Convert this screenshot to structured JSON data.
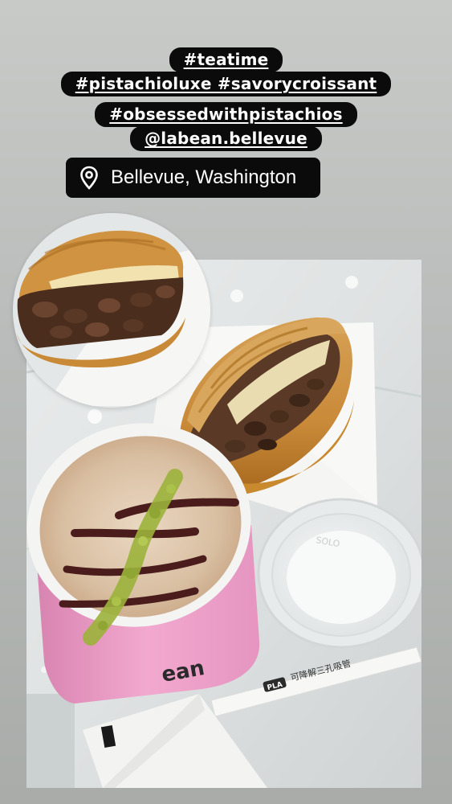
{
  "hashtags": [
    "#teatime",
    "#pistachioluxe #savorycroissant",
    "#obsessedwithpistachios",
    "@labean.bellevue"
  ],
  "location": {
    "label": "Bellevue, Washington",
    "icon": "location-pin-icon"
  },
  "photo_text": {
    "cup_brand": "ean",
    "lid_embossing": "SOLO",
    "straw_wrapper_badge": "PLA",
    "straw_wrapper_text": "可降解三孔吸管"
  },
  "colors": {
    "background": "#bfc1bf",
    "sticker_bg": "#0b0b0b",
    "sticker_text": "#ffffff",
    "cup_pink": "#ef9fc8",
    "pistachio": "#9bb23b"
  }
}
